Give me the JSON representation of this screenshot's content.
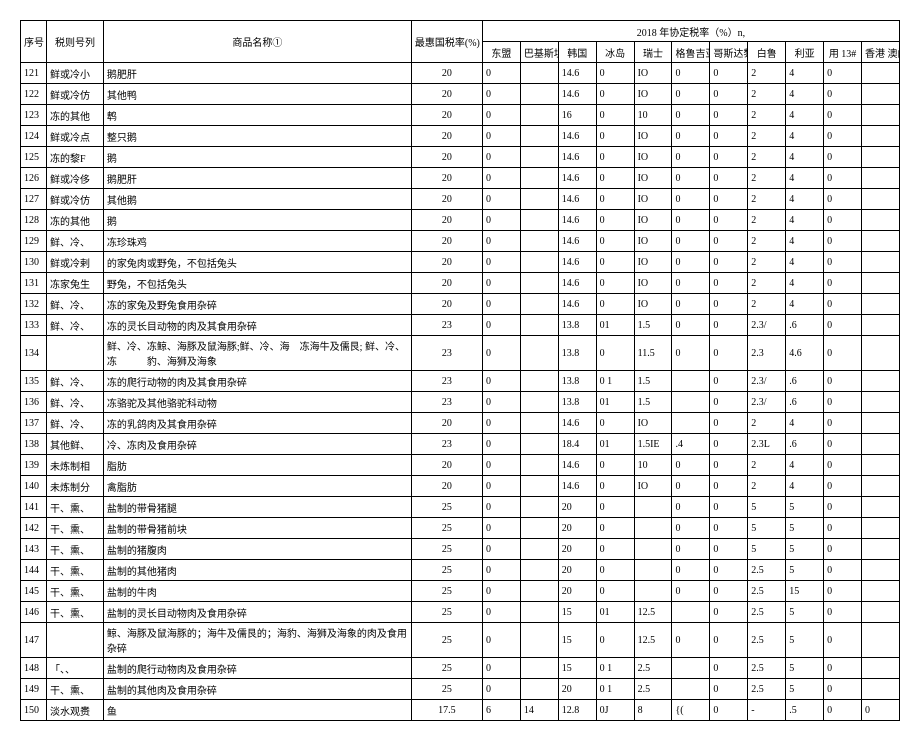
{
  "header": {
    "seq": "序号",
    "code": "税则号列",
    "name": "商品名称①",
    "mfn": "最惠国税率(%)",
    "group": "2018 年协定税率（%）n,",
    "cols": [
      "东盟",
      "巴基斯坦",
      "韩国",
      "冰岛",
      "瑞士",
      "格鲁吉亚",
      "哥斯达黎加",
      "白鲁",
      "利亚",
      "用 13#",
      "香港 澳门"
    ]
  },
  "rows": [
    {
      "seq": "121",
      "code": "鲜或冷小",
      "name": "鹅肥肝",
      "mfn": "20",
      "r": [
        "0",
        "",
        "14.6",
        "0",
        "IO",
        "0",
        "0",
        "2",
        "4",
        "0",
        ""
      ]
    },
    {
      "seq": "122",
      "code": "鲜或冷仿",
      "name": "其他鸭",
      "mfn": "20",
      "r": [
        "0",
        "",
        "14.6",
        "0",
        "IO",
        "0",
        "0",
        "2",
        "4",
        "0",
        ""
      ]
    },
    {
      "seq": "123",
      "code": "冻的其他",
      "name": "鹎",
      "mfn": "20",
      "r": [
        "0",
        "",
        "16",
        "0",
        "10",
        "0",
        "0",
        "2",
        "4",
        "0",
        ""
      ]
    },
    {
      "seq": "124",
      "code": "鲜或冷点",
      "name": "整只鹅",
      "mfn": "20",
      "r": [
        "0",
        "",
        "14.6",
        "0",
        "IO",
        "0",
        "0",
        "2",
        "4",
        "0",
        ""
      ]
    },
    {
      "seq": "125",
      "code": "冻的黎F",
      "name": "鹅",
      "mfn": "20",
      "r": [
        "0",
        "",
        "14.6",
        "0",
        "IO",
        "0",
        "0",
        "2",
        "4",
        "0",
        ""
      ]
    },
    {
      "seq": "126",
      "code": "鲜或冷侈",
      "name": "鹅肥肝",
      "mfn": "20",
      "r": [
        "0",
        "",
        "14.6",
        "0",
        "IO",
        "0",
        "0",
        "2",
        "4",
        "0",
        ""
      ]
    },
    {
      "seq": "127",
      "code": "鲜或冷仿",
      "name": "其他鹅",
      "mfn": "20",
      "r": [
        "0",
        "",
        "14.6",
        "0",
        "IO",
        "0",
        "0",
        "2",
        "4",
        "0",
        ""
      ]
    },
    {
      "seq": "128",
      "code": "冻的其他",
      "name": "鹅",
      "mfn": "20",
      "r": [
        "0",
        "",
        "14.6",
        "0",
        "IO",
        "0",
        "0",
        "2",
        "4",
        "0",
        ""
      ]
    },
    {
      "seq": "129",
      "code": "鲜、冷、",
      "name": "冻珍珠鸡",
      "mfn": "20",
      "r": [
        "0",
        "",
        "14.6",
        "0",
        "IO",
        "0",
        "0",
        "2",
        "4",
        "0",
        ""
      ]
    },
    {
      "seq": "130",
      "code": "鲜或冷剌",
      "name": "的家兔肉或野兔，不包括兔头",
      "mfn": "20",
      "r": [
        "0",
        "",
        "14.6",
        "0",
        "IO",
        "0",
        "0",
        "2",
        "4",
        "0",
        ""
      ]
    },
    {
      "seq": "131",
      "code": "冻家兔生",
      "name": "野兔，不包括兔头",
      "mfn": "20",
      "r": [
        "0",
        "",
        "14.6",
        "0",
        "IO",
        "0",
        "0",
        "2",
        "4",
        "0",
        ""
      ]
    },
    {
      "seq": "132",
      "code": "鲜、冷、",
      "name": "冻的家兔及野兔食用杂碎",
      "mfn": "20",
      "r": [
        "0",
        "",
        "14.6",
        "0",
        "IO",
        "0",
        "0",
        "2",
        "4",
        "0",
        ""
      ]
    },
    {
      "seq": "133",
      "code": "鲜、冷、",
      "name": "冻的灵长目动物的肉及其食用杂碎",
      "mfn": "23",
      "r": [
        "0",
        "",
        "13.8",
        "01",
        "1.5",
        "0",
        "0",
        "2.3/",
        ".6",
        "0",
        ""
      ]
    },
    {
      "seq": "134",
      "code": "",
      "name": "鲜、冷、冻鲸、海豚及鼠海豚;鲜、冷、海　冻海牛及儒艮; 鲜、冷、冻　　　豹、海狮及海象",
      "mfn": "23",
      "r": [
        "0",
        "",
        "13.8",
        "0",
        "11.5",
        "0",
        "0",
        "2.3",
        "4.6",
        "0",
        ""
      ],
      "tall": true
    },
    {
      "seq": "135",
      "code": "鲜、冷、",
      "name": "冻的爬行动物的肉及其食用杂碎",
      "mfn": "23",
      "r": [
        "0",
        "",
        "13.8",
        "0  1",
        "1.5",
        "",
        "0",
        "2.3/",
        ".6",
        "0",
        ""
      ]
    },
    {
      "seq": "136",
      "code": "鲜、冷、",
      "name": "冻骆驼及其他骆驼科动物",
      "mfn": "23",
      "r": [
        "0",
        "",
        "13.8",
        "01",
        "1.5",
        "",
        "0",
        "2.3/",
        ".6",
        "0",
        ""
      ]
    },
    {
      "seq": "137",
      "code": "鲜、冷、",
      "name": "冻的乳鸽肉及其食用杂碎",
      "mfn": "20",
      "r": [
        "0",
        "",
        "14.6",
        "0",
        "IO",
        "",
        "0",
        "2",
        "4",
        "0",
        ""
      ]
    },
    {
      "seq": "138",
      "code": "其他鲜、",
      "name": "冷、冻肉及食用杂碎",
      "mfn": "23",
      "r": [
        "0",
        "",
        "18.4",
        "01",
        "1.5IE",
        ".4",
        "0",
        "2.3L",
        ".6",
        "0",
        ""
      ]
    },
    {
      "seq": "139",
      "code": "未炼制相",
      "name": "脂肪",
      "mfn": "20",
      "r": [
        "0",
        "",
        "14.6",
        "0",
        "10",
        "0",
        "0",
        "2",
        "4",
        "0",
        ""
      ]
    },
    {
      "seq": "140",
      "code": "未炼制分",
      "name": "禽脂肪",
      "mfn": "20",
      "r": [
        "0",
        "",
        "14.6",
        "0",
        "IO",
        "0",
        "0",
        "2",
        "4",
        "0",
        ""
      ]
    },
    {
      "seq": "141",
      "code": "干、熏、",
      "name": "盐制的带骨猪腿",
      "mfn": "25",
      "r": [
        "0",
        "",
        "20",
        "0",
        "",
        "0",
        "0",
        "5",
        "5",
        "0",
        ""
      ]
    },
    {
      "seq": "142",
      "code": "干、熏、",
      "name": "盐制的带骨猪前块",
      "mfn": "25",
      "r": [
        "0",
        "",
        "20",
        "0",
        "",
        "0",
        "0",
        "5",
        "5",
        "0",
        ""
      ]
    },
    {
      "seq": "143",
      "code": "干、熏、",
      "name": "盐制的猪腹肉",
      "mfn": "25",
      "r": [
        "0",
        "",
        "20",
        "0",
        "",
        "0",
        "0",
        "5",
        "5",
        "0",
        ""
      ]
    },
    {
      "seq": "144",
      "code": "干、熏、",
      "name": "盐制的其他猪肉",
      "mfn": "25",
      "r": [
        "0",
        "",
        "20",
        "0",
        "",
        "0",
        "0",
        "2.5",
        "5",
        "0",
        ""
      ]
    },
    {
      "seq": "145",
      "code": "干、熏、",
      "name": "盐制的牛肉",
      "mfn": "25",
      "r": [
        "0",
        "",
        "20",
        "0",
        "",
        "0",
        "0",
        "2.5",
        "15",
        "0",
        ""
      ]
    },
    {
      "seq": "146",
      "code": "干、熏、",
      "name": "盐制的灵长目动物肉及食用杂碎",
      "mfn": "25",
      "r": [
        "0",
        "",
        "15",
        "01",
        "12.5",
        "",
        "0",
        "2.5",
        "5",
        "0",
        ""
      ]
    },
    {
      "seq": "147",
      "code": "",
      "name": "鲸、海豚及鼠海豚的；海牛及儒艮的；海豹、海狮及海象的肉及食用杂碎",
      "mfn": "25",
      "r": [
        "0",
        "",
        "15",
        "0",
        "12.5",
        "0",
        "0",
        "2.5",
        "5",
        "0",
        ""
      ],
      "tall": true
    },
    {
      "seq": "148",
      "code": "「、、",
      "name": "盐制的爬行动物肉及食用杂碎",
      "mfn": "25",
      "r": [
        "0",
        "",
        "15",
        "0   1",
        "2.5",
        "",
        "0",
        "2.5",
        "5",
        "0",
        ""
      ]
    },
    {
      "seq": "149",
      "code": "干、熏、",
      "name": "盐制的其他肉及食用杂碎",
      "mfn": "25",
      "r": [
        "0",
        "",
        "20",
        "0  1",
        "2.5",
        "",
        "0",
        "2.5",
        "5",
        "0",
        ""
      ]
    },
    {
      "seq": "150",
      "code": "淡水观赉",
      "name": "鱼",
      "mfn": "17.5",
      "r": [
        "6",
        "14",
        "12.8",
        "0J",
        "8",
        "{(",
        "0",
        "-",
        ".5",
        "0",
        "0"
      ]
    }
  ]
}
